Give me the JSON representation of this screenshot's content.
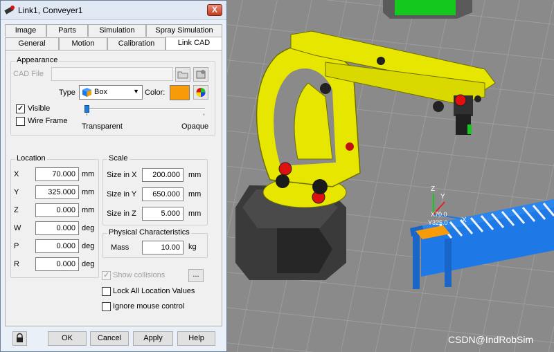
{
  "window": {
    "title": "Link1, Conveyer1",
    "close_label": "X"
  },
  "tabs_row1": [
    "Image",
    "Parts",
    "Simulation",
    "Spray Simulation"
  ],
  "tabs_row2": [
    "General",
    "Motion",
    "Calibration",
    "Link CAD"
  ],
  "active_tab": "Link CAD",
  "appearance": {
    "group_title": "Appearance",
    "cad_file_label": "CAD File",
    "cad_file_value": "",
    "type_label": "Type",
    "type_value": "Box",
    "color_label": "Color:",
    "color_value": "#F79B08",
    "visible_label": "Visible",
    "visible_checked": true,
    "wireframe_label": "Wire Frame",
    "wireframe_checked": false,
    "transparent_label": "Transparent",
    "opaque_label": "Opaque",
    "opacity_fraction": 0.0
  },
  "location": {
    "group_title": "Location",
    "fields": [
      {
        "label": "X",
        "value": "70.000",
        "unit": "mm"
      },
      {
        "label": "Y",
        "value": "325.000",
        "unit": "mm"
      },
      {
        "label": "Z",
        "value": "0.000",
        "unit": "mm"
      },
      {
        "label": "W",
        "value": "0.000",
        "unit": "deg"
      },
      {
        "label": "P",
        "value": "0.000",
        "unit": "deg"
      },
      {
        "label": "R",
        "value": "0.000",
        "unit": "deg"
      }
    ]
  },
  "scale": {
    "group_title": "Scale",
    "fields": [
      {
        "label": "Size in X",
        "value": "200.000",
        "unit": "mm"
      },
      {
        "label": "Size in Y",
        "value": "650.000",
        "unit": "mm"
      },
      {
        "label": "Size in Z",
        "value": "5.000",
        "unit": "mm"
      }
    ]
  },
  "physical": {
    "group_title": "Physical Characteristics",
    "mass_label": "Mass",
    "mass_value": "10.00",
    "mass_unit": "kg"
  },
  "options": {
    "show_collisions_label": "Show collisions",
    "show_collisions_button": "...",
    "lock_location_label": "Lock All Location Values",
    "ignore_mouse_label": "Ignore mouse control"
  },
  "buttons": {
    "ok": "OK",
    "cancel": "Cancel",
    "apply": "Apply",
    "help": "Help"
  },
  "viewport": {
    "axis_labels": {
      "z": "Z",
      "y": "Y",
      "x": "X"
    },
    "axis_readout_1": "X70.0",
    "axis_readout_2": "Y325.0",
    "watermark": "CSDN@IndRobSim"
  },
  "colors": {
    "robot": "#E6E600",
    "conveyor": "#1E78E6",
    "part": "#F79B08",
    "accent_green": "#14C81E",
    "base": "#333333"
  }
}
